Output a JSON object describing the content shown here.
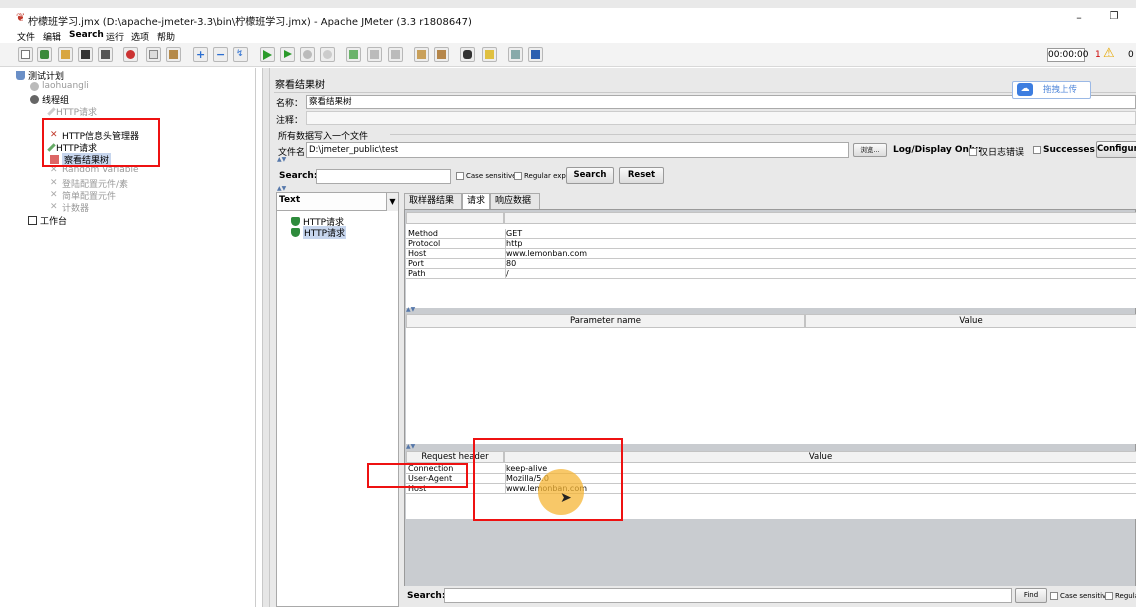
{
  "window": {
    "title": "柠檬班学习.jmx (D:\\apache-jmeter-3.3\\bin\\柠檬班学习.jmx) - Apache JMeter (3.3 r1808647)",
    "minimize": "–",
    "maximize": "❐"
  },
  "menu": [
    "文件",
    "编辑",
    "Search",
    "运行",
    "选项",
    "帮助"
  ],
  "toolbar": {
    "timer": "00:00:00",
    "error_count": "1",
    "warn_symbol": "⚠",
    "active_threads": "0"
  },
  "tree": {
    "items": [
      {
        "label": "测试计划",
        "icon": "flask-icon",
        "enabled": true
      },
      {
        "label": "laohuangli",
        "icon": "gear-icon",
        "enabled": false
      },
      {
        "label": "线程组",
        "icon": "gear-icon",
        "enabled": true
      },
      {
        "label": "HTTP请求",
        "icon": "pencil-icon",
        "enabled": false
      },
      {
        "label": "HTTP信息头管理器",
        "icon": "tools-icon",
        "enabled": true
      },
      {
        "label": "HTTP请求",
        "icon": "pencil-icon",
        "enabled": true
      },
      {
        "label": "察看结果树",
        "icon": "chart-icon",
        "enabled": true,
        "selected": true
      },
      {
        "label": "Random Variable",
        "icon": "tools-icon",
        "enabled": false
      },
      {
        "label": "登陆配置元件/素",
        "icon": "tools-icon",
        "enabled": false
      },
      {
        "label": "简单配置元件",
        "icon": "tools-icon",
        "enabled": false
      },
      {
        "label": "计数器",
        "icon": "tools-icon",
        "enabled": false
      },
      {
        "label": "工作台",
        "icon": "workbench-icon",
        "enabled": true
      }
    ]
  },
  "panel": {
    "title": "察看结果树",
    "name_label": "名称：",
    "name_value": "察看结果树",
    "comment_label": "注释：",
    "comment_value": "",
    "write_section": "所有数据写入一个文件",
    "filename_label": "文件名",
    "filename_value": "D:\\jmeter_public\\test",
    "browse_label": "浏览...",
    "log_display_only": "Log/Display Only:",
    "errors_only": "仅日志错误",
    "successes": "Successes",
    "configure": "Configure"
  },
  "search": {
    "label": "Search:",
    "value": "",
    "case_sensitive": "Case sensitive",
    "regular_exp": "Regular exp.",
    "search_button": "Search",
    "reset_button": "Reset"
  },
  "baidu": {
    "label": "拖拽上传",
    "icon": "cloud-icon"
  },
  "results": {
    "renderer": "Text",
    "items": [
      "HTTP请求",
      "HTTP请求"
    ]
  },
  "tabs": [
    "取样器结果",
    "请求",
    "响应数据"
  ],
  "request_table": [
    {
      "key": "Method",
      "value": "GET"
    },
    {
      "key": "Protocol",
      "value": "http"
    },
    {
      "key": "Host",
      "value": "www.lemonban.com"
    },
    {
      "key": "Port",
      "value": "80"
    },
    {
      "key": "Path",
      "value": "/"
    }
  ],
  "params_table": {
    "headers": [
      "Parameter name",
      "Value"
    ]
  },
  "headers_table": {
    "headers": [
      "Request header",
      "Value"
    ],
    "rows": [
      {
        "key": "Connection",
        "value": "keep-alive"
      },
      {
        "key": "User-Agent",
        "value": "Mozilla/5.0"
      },
      {
        "key": "Host",
        "value": "www.lemonban.com"
      }
    ]
  },
  "bottom_search": {
    "label": "Search:",
    "find": "Find",
    "case_sensitive": "Case sensitive",
    "regular": "Regular"
  },
  "colors": {
    "highlight": "#e11111",
    "selection": "#c7d6ee",
    "cursor": "#f5b636"
  }
}
